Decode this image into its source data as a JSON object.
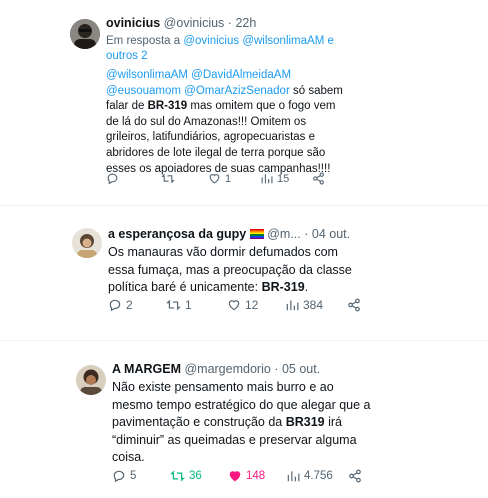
{
  "tweet1": {
    "name": "ovinicius",
    "handle": "@ovinicius",
    "dot": "·",
    "time": "22h",
    "reply_prefix": "Em resposta a ",
    "reply_to": "@ovinicius @wilsonlimaAM e",
    "reply_more": "outros 2",
    "mentions1": "@wilsonlimaAM @DavidAlmeidaAM",
    "mentions2": "@eusouamom @OmarAzizSenador",
    "text_a": " só sabem",
    "text_b": "falar de ",
    "bold1": "BR-319",
    "text_c": " mas omitem que o fogo vem",
    "text_d": "de lá do sul do Amazonas!!! Omitem os",
    "text_e": "grileiros, latifundiários, agropecuaristas e",
    "text_f": "abridores de lote ilegal de terra porque são",
    "text_g": "esses os apoiadores de suas campanhas!!!!",
    "replies": "",
    "retweets": "",
    "likes": "1",
    "views": "15"
  },
  "tweet2": {
    "name": "a esperançosa da gupy",
    "handle": "@m...",
    "dot": "·",
    "time": "04 out.",
    "line1": "Os manauras vão dormir defumados com",
    "line2": "essa fumaça, mas a preocupação da classe",
    "line3a": "política baré é unicamente: ",
    "bold1": "BR-319",
    "line3b": ".",
    "replies": "2",
    "retweets": "1",
    "likes": "12",
    "views": "384"
  },
  "tweet3": {
    "name": "A MARGEM",
    "handle": "@margemdorio",
    "dot": "·",
    "time": "05 out.",
    "line1": "Não existe pensamento mais burro e ao",
    "line2": "mesmo tempo estratégico do que alegar que a",
    "line3a": "pavimentação e construção da ",
    "bold1": "BR319",
    "line3b": " irá",
    "line4": "“diminuir” as queimadas e preservar alguma",
    "line5": "coisa.",
    "replies": "5",
    "retweets": "36",
    "likes": "148",
    "views": "4.756"
  },
  "colors": {
    "link": "#1d9bf0",
    "retweet_active": "#00ba7c",
    "like_active": "#f91880",
    "muted": "#536471"
  }
}
